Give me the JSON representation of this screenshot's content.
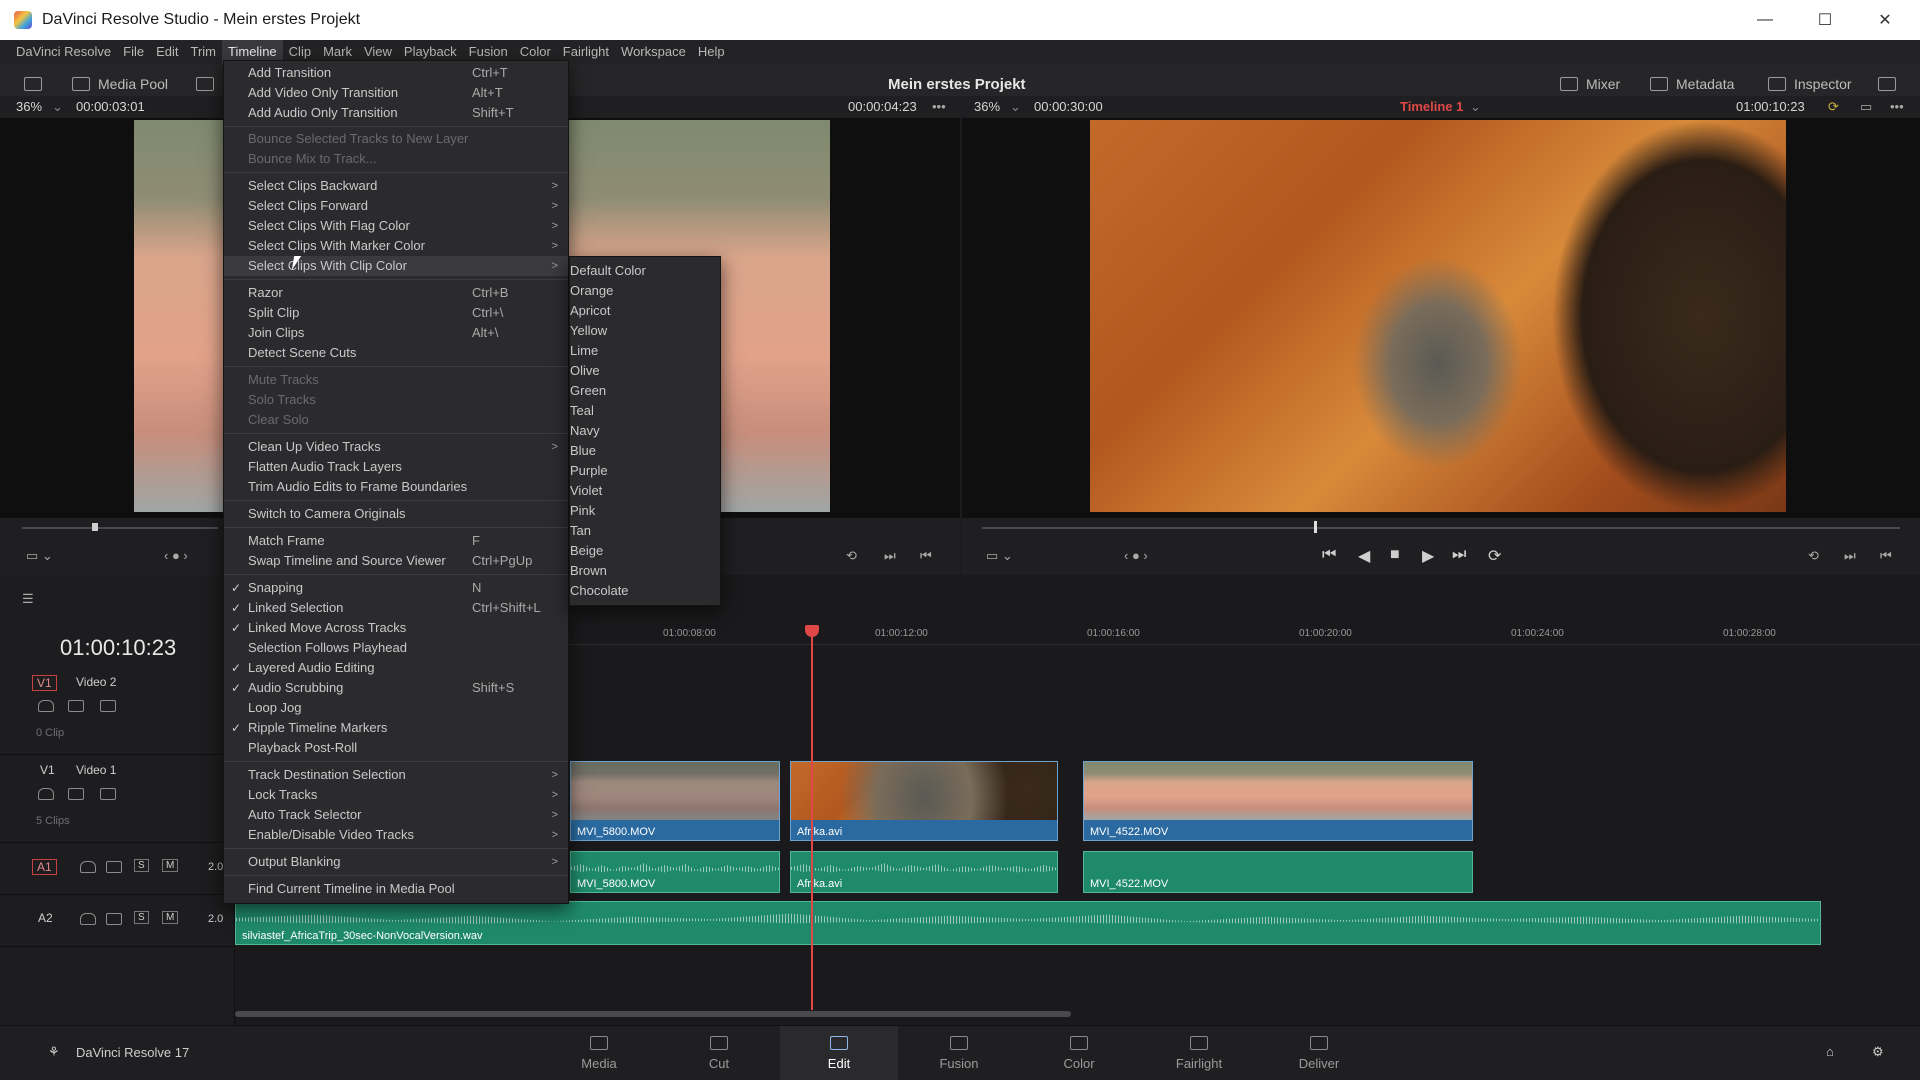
{
  "window": {
    "title": "DaVinci Resolve Studio - Mein erstes Projekt",
    "minimize": "—",
    "maximize": "☐",
    "close": "✕"
  },
  "menubar": [
    "DaVinci Resolve",
    "File",
    "Edit",
    "Trim",
    "Timeline",
    "Clip",
    "Mark",
    "View",
    "Playback",
    "Fusion",
    "Color",
    "Fairlight",
    "Workspace",
    "Help"
  ],
  "toolbar": {
    "media_pool": "Media Pool",
    "project_title": "Mein erstes Projekt",
    "mixer": "Mixer",
    "metadata": "Metadata",
    "inspector": "Inspector"
  },
  "source_viewer": {
    "zoom": "36%",
    "timecode_left": "00:00:03:01",
    "timecode_right": "00:00:04:23"
  },
  "timeline_viewer": {
    "zoom": "36%",
    "duration": "00:00:30:00",
    "timeline_name": "Timeline 1",
    "timecode": "01:00:10:23"
  },
  "timeline": {
    "current_timecode": "01:00:10:23",
    "ruler": [
      "01:00:08:00",
      "01:00:12:00",
      "01:00:16:00",
      "01:00:20:00",
      "01:00:24:00",
      "01:00:28:00"
    ],
    "tracks": {
      "v2": {
        "id": "V1",
        "name": "Video 2",
        "clips": "0 Clip"
      },
      "v1": {
        "id": "V1",
        "name": "Video 1",
        "clips": "5 Clips"
      },
      "a1": {
        "id": "A1",
        "level": "2.0",
        "s": "S",
        "m": "M"
      },
      "a2": {
        "id": "A2",
        "level": "2.0",
        "s": "S",
        "m": "M"
      }
    },
    "clips": {
      "v_mvi5800": "MVI_5800.MOV",
      "v_afrika": "Afrika.avi",
      "v_mvi4522": "MVI_4522.MOV",
      "a_mvi5800": "MVI_5800.MOV",
      "a_afrika": "Afrika.avi",
      "a_mvi4522": "MVI_4522.MOV",
      "a2_music": "silviastef_AfricaTrip_30sec-NonVocalVersion.wav"
    }
  },
  "timeline_menu": {
    "items": [
      {
        "label": "Add Transition",
        "shortcut": "Ctrl+T"
      },
      {
        "label": "Add Video Only Transition",
        "shortcut": "Alt+T"
      },
      {
        "label": "Add Audio Only Transition",
        "shortcut": "Shift+T"
      },
      {
        "label": "Bounce Selected Tracks to New Layer",
        "disabled": true
      },
      {
        "label": "Bounce Mix to Track...",
        "disabled": true
      },
      {
        "label": "Select Clips Backward",
        "submenu": true
      },
      {
        "label": "Select Clips Forward",
        "submenu": true
      },
      {
        "label": "Select Clips With Flag Color",
        "submenu": true
      },
      {
        "label": "Select Clips With Marker Color",
        "submenu": true
      },
      {
        "label": "Select Clips With Clip Color",
        "submenu": true,
        "highlighted": true
      },
      {
        "label": "Razor",
        "shortcut": "Ctrl+B"
      },
      {
        "label": "Split Clip",
        "shortcut": "Ctrl+\\"
      },
      {
        "label": "Join Clips",
        "shortcut": "Alt+\\"
      },
      {
        "label": "Detect Scene Cuts"
      },
      {
        "label": "Mute Tracks",
        "disabled": true
      },
      {
        "label": "Solo Tracks",
        "disabled": true
      },
      {
        "label": "Clear Solo",
        "disabled": true
      },
      {
        "label": "Clean Up Video Tracks",
        "submenu": true
      },
      {
        "label": "Flatten Audio Track Layers"
      },
      {
        "label": "Trim Audio Edits to Frame Boundaries"
      },
      {
        "label": "Switch to Camera Originals"
      },
      {
        "label": "Match Frame",
        "shortcut": "F"
      },
      {
        "label": "Swap Timeline and Source Viewer",
        "shortcut": "Ctrl+PgUp"
      },
      {
        "label": "Snapping",
        "shortcut": "N",
        "checked": true
      },
      {
        "label": "Linked Selection",
        "shortcut": "Ctrl+Shift+L",
        "checked": true
      },
      {
        "label": "Linked Move Across Tracks",
        "checked": true
      },
      {
        "label": "Selection Follows Playhead"
      },
      {
        "label": "Layered Audio Editing",
        "checked": true
      },
      {
        "label": "Audio Scrubbing",
        "shortcut": "Shift+S",
        "checked": true
      },
      {
        "label": "Loop Jog"
      },
      {
        "label": "Ripple Timeline Markers",
        "checked": true
      },
      {
        "label": "Playback Post-Roll"
      },
      {
        "label": "Track Destination Selection",
        "submenu": true
      },
      {
        "label": "Lock Tracks",
        "submenu": true
      },
      {
        "label": "Auto Track Selector",
        "submenu": true
      },
      {
        "label": "Enable/Disable Video Tracks",
        "submenu": true
      },
      {
        "label": "Output Blanking",
        "submenu": true
      },
      {
        "label": "Find Current Timeline in Media Pool"
      }
    ]
  },
  "clip_color_submenu": [
    "Default Color",
    "Orange",
    "Apricot",
    "Yellow",
    "Lime",
    "Olive",
    "Green",
    "Teal",
    "Navy",
    "Blue",
    "Purple",
    "Violet",
    "Pink",
    "Tan",
    "Beige",
    "Brown",
    "Chocolate"
  ],
  "pages": [
    "Media",
    "Cut",
    "Edit",
    "Fusion",
    "Color",
    "Fairlight",
    "Deliver"
  ],
  "active_page": "Edit",
  "app_version": "DaVinci Resolve 17",
  "colors": {
    "accent_red": "#e04848",
    "video_clip": "#2b6aa0",
    "audio_clip": "#1f8a6a"
  }
}
